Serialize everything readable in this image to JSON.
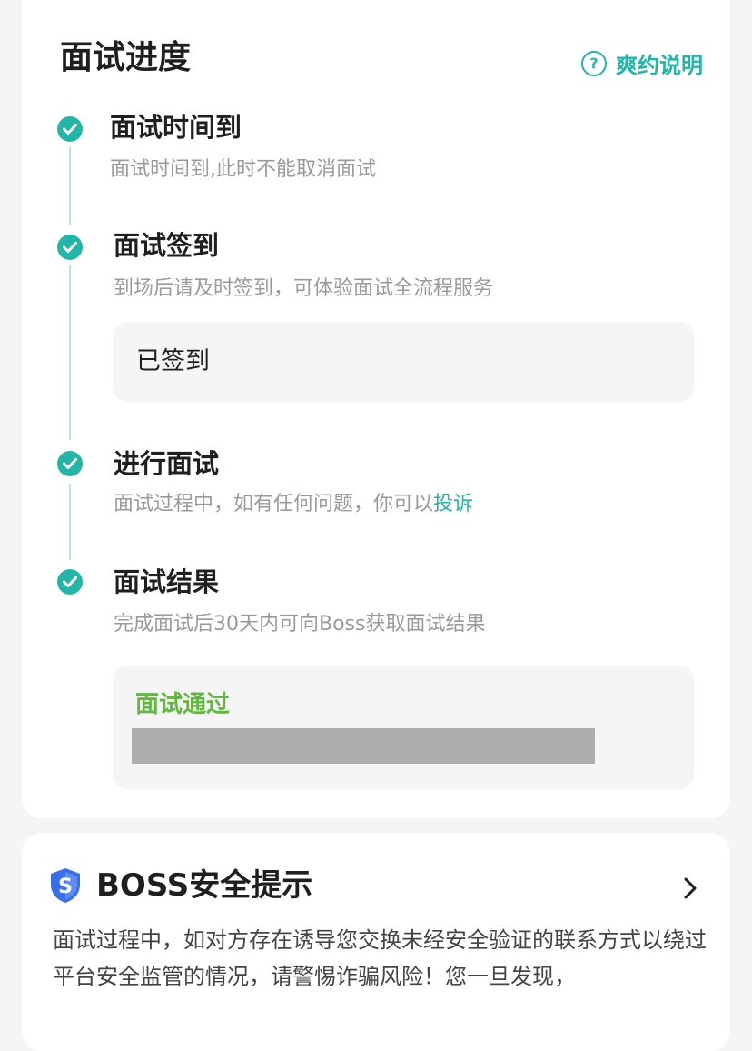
{
  "progress": {
    "title": "面试进度",
    "rules_label": "爽约说明",
    "steps": [
      {
        "title": "面试时间到",
        "desc": "面试时间到,此时不能取消面试"
      },
      {
        "title": "面试签到",
        "desc": "到场后请及时签到，可体验面试全流程服务",
        "status": "已签到"
      },
      {
        "title": "进行面试",
        "desc": "面试过程中，如有任何问题，你可以",
        "link": "投诉"
      },
      {
        "title": "面试结果",
        "desc": "完成面试后30天内可向Boss获取面试结果",
        "result": "面试通过"
      }
    ]
  },
  "safety": {
    "title": "BOSS安全提示",
    "text": "面试过程中，如对方存在诱导您交换未经安全验证的联系方式以绕过平台安全监管的情况，请警惕诈骗风险！您一旦发现，"
  },
  "colors": {
    "accent": "#22b5a8",
    "pass": "#62b83e",
    "shield": "#3a6ee8"
  }
}
